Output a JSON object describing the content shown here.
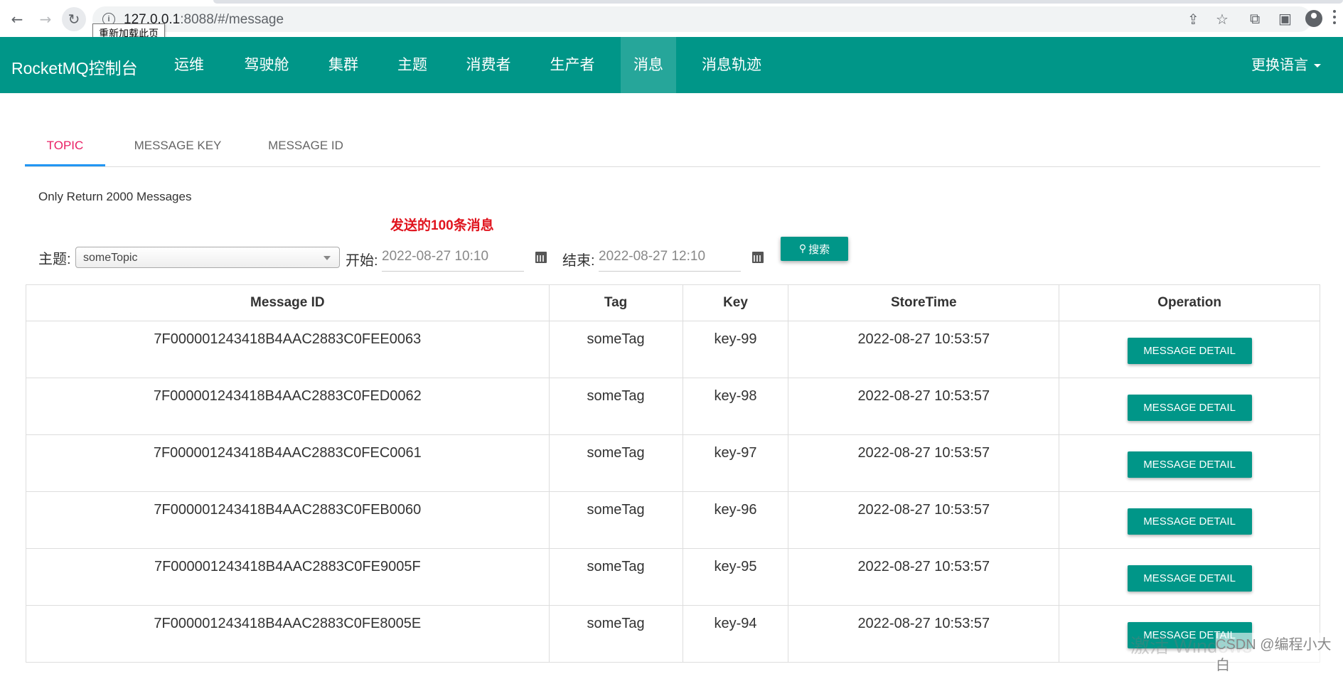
{
  "browser": {
    "url_host": "127.0.0.1",
    "url_rest": ":8088/#/message",
    "tooltip": "重新加载此页"
  },
  "navbar": {
    "brand": "RocketMQ控制台",
    "items": [
      "运维",
      "驾驶舱",
      "集群",
      "主题",
      "消费者",
      "生产者",
      "消息",
      "消息轨迹"
    ],
    "active_item": "消息",
    "language": "更换语言"
  },
  "tabs": [
    "TOPIC",
    "MESSAGE KEY",
    "MESSAGE ID"
  ],
  "active_tab": "TOPIC",
  "notice": "Only Return 2000 Messages",
  "annotation": "发送的100条消息",
  "form": {
    "topic_label": "主题:",
    "topic_value": "someTopic",
    "start_label": "开始:",
    "start_value": "2022-08-27 10:10",
    "end_label": "结束:",
    "end_value": "2022-08-27 12:10",
    "search_label": "搜索"
  },
  "table": {
    "headers": [
      "Message ID",
      "Tag",
      "Key",
      "StoreTime",
      "Operation"
    ],
    "detail_label": "MESSAGE DETAIL",
    "rows": [
      {
        "id": "7F000001243418B4AAC2883C0FEE0063",
        "tag": "someTag",
        "key": "key-99",
        "time": "2022-08-27 10:53:57"
      },
      {
        "id": "7F000001243418B4AAC2883C0FED0062",
        "tag": "someTag",
        "key": "key-98",
        "time": "2022-08-27 10:53:57"
      },
      {
        "id": "7F000001243418B4AAC2883C0FEC0061",
        "tag": "someTag",
        "key": "key-97",
        "time": "2022-08-27 10:53:57"
      },
      {
        "id": "7F000001243418B4AAC2883C0FEB0060",
        "tag": "someTag",
        "key": "key-96",
        "time": "2022-08-27 10:53:57"
      },
      {
        "id": "7F000001243418B4AAC2883C0FE9005F",
        "tag": "someTag",
        "key": "key-95",
        "time": "2022-08-27 10:53:57"
      },
      {
        "id": "7F000001243418B4AAC2883C0FE8005E",
        "tag": "someTag",
        "key": "key-94",
        "time": "2022-08-27 10:53:57"
      }
    ]
  },
  "watermark": "激活 Windows",
  "credit": "CSDN @编程小大白",
  "colors": {
    "primary": "#009688",
    "active_tab": "#e91e63",
    "annotation": "#e0141e"
  }
}
